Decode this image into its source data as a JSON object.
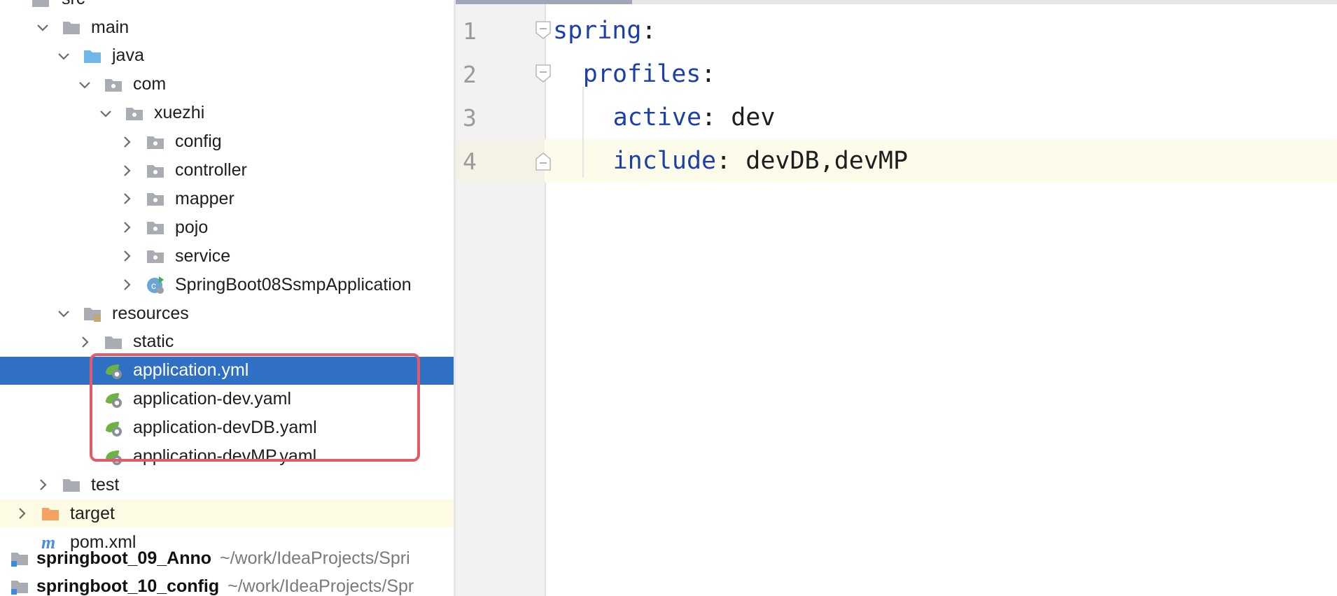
{
  "project_tree": {
    "top_cut_label": "src",
    "items": [
      {
        "label": "main",
        "chevron": "down",
        "icon": "folder-icon",
        "indent": 0
      },
      {
        "label": "java",
        "chevron": "down",
        "icon": "source-folder-icon",
        "indent": 1
      },
      {
        "label": "com",
        "chevron": "down",
        "icon": "package-icon",
        "indent": 2
      },
      {
        "label": "xuezhi",
        "chevron": "down",
        "icon": "package-icon",
        "indent": 3
      },
      {
        "label": "config",
        "chevron": "right",
        "icon": "package-icon",
        "indent": 4
      },
      {
        "label": "controller",
        "chevron": "right",
        "icon": "package-icon",
        "indent": 4
      },
      {
        "label": "mapper",
        "chevron": "right",
        "icon": "package-icon",
        "indent": 4
      },
      {
        "label": "pojo",
        "chevron": "right",
        "icon": "package-icon",
        "indent": 4
      },
      {
        "label": "service",
        "chevron": "right",
        "icon": "package-icon",
        "indent": 4
      },
      {
        "label": "SpringBoot08SsmpApplication",
        "chevron": "right",
        "icon": "spring-class-icon",
        "indent": 4
      },
      {
        "label": "resources",
        "chevron": "down",
        "icon": "resources-folder-icon",
        "indent": 1
      },
      {
        "label": "static",
        "chevron": "right",
        "icon": "folder-icon",
        "indent": 2
      },
      {
        "label": "application.yml",
        "chevron": "none",
        "icon": "spring-yaml-icon",
        "indent": 2,
        "selected": true
      },
      {
        "label": "application-dev.yaml",
        "chevron": "none",
        "icon": "spring-yaml-icon",
        "indent": 2
      },
      {
        "label": "application-devDB.yaml",
        "chevron": "none",
        "icon": "spring-yaml-icon",
        "indent": 2
      },
      {
        "label": "application-devMP.yaml",
        "chevron": "none",
        "icon": "spring-yaml-icon",
        "indent": 2
      },
      {
        "label": "test",
        "chevron": "right",
        "icon": "folder-icon",
        "indent": 0
      },
      {
        "label": "target",
        "chevron": "right",
        "icon": "excluded-folder-icon",
        "indent": -1,
        "excluded": true
      },
      {
        "label": "pom.xml",
        "chevron": "none",
        "icon": "maven-icon",
        "indent": -1
      }
    ],
    "projects": [
      {
        "name": "springboot_09_Anno",
        "path": "~/work/IdeaProjects/Spri"
      },
      {
        "name": "springboot_10_config",
        "path": "~/work/IdeaProjects/Spr"
      }
    ]
  },
  "editor": {
    "lines": [
      {
        "num": "1",
        "indent": "",
        "key": "spring",
        "sep": ":",
        "value": ""
      },
      {
        "num": "2",
        "indent": "  ",
        "key": "profiles",
        "sep": ":",
        "value": ""
      },
      {
        "num": "3",
        "indent": "    ",
        "key": "active",
        "sep": ": ",
        "value": "dev"
      },
      {
        "num": "4",
        "indent": "    ",
        "key": "include",
        "sep": ": ",
        "value": "devDB,devMP"
      }
    ],
    "current_line": 4
  },
  "colors": {
    "selection": "#2f6fc4",
    "yaml_key": "#1c3fa8",
    "highlight_box": "#e25b6b",
    "excluded_row": "#fdfbe3",
    "current_line": "#fdfbea"
  }
}
